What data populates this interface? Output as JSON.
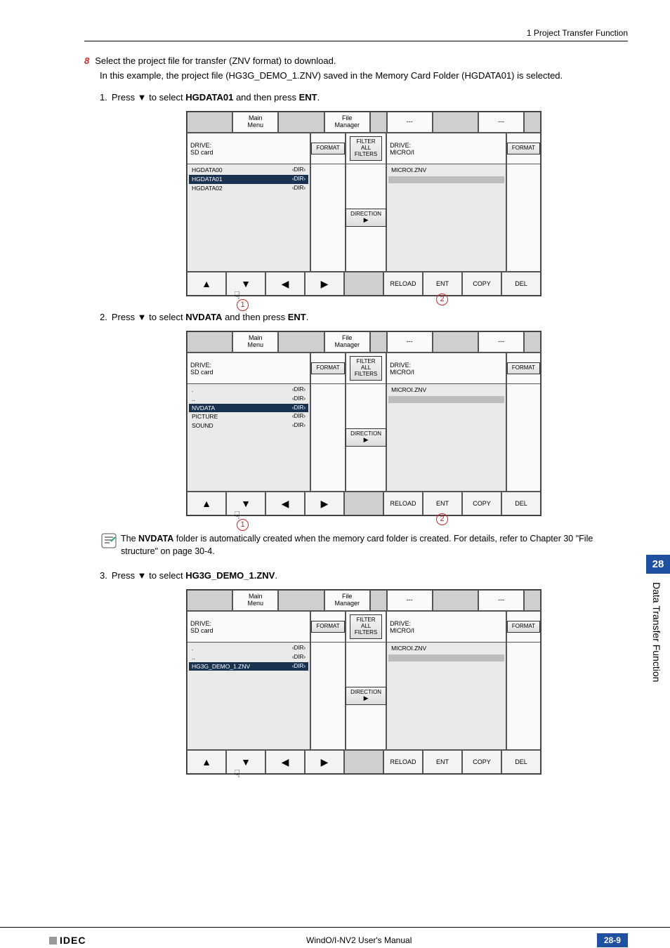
{
  "header": {
    "section": "1 Project Transfer Function"
  },
  "step8": {
    "num": "8",
    "line1": "Select the project file for transfer (ZNV format) to download.",
    "line2": "In this example, the project file (HG3G_DEMO_1.ZNV) saved in the Memory Card Folder (HGDATA01) is selected."
  },
  "sub1": {
    "num": "1.",
    "pre": "Press ▼ to select ",
    "bold1": "HGDATA01",
    "mid": " and then press ",
    "bold2": "ENT",
    "post": "."
  },
  "sub2": {
    "num": "2.",
    "pre": "Press ▼ to select ",
    "bold1": "NVDATA",
    "mid": " and then press ",
    "bold2": "ENT",
    "post": "."
  },
  "sub3": {
    "num": "3.",
    "pre": "Press ▼ to select ",
    "bold1": "HG3G_DEMO_1.ZNV",
    "post": "."
  },
  "note": {
    "pre": "The ",
    "bold": "NVDATA",
    "rest": " folder is automatically created when the memory card folder is created. For details, refer to Chapter 30 \"File structure\" on page 30-4."
  },
  "panel_common": {
    "main_menu": "Main\nMenu",
    "file_manager": "File\nManager",
    "dashes": "---",
    "drive_label": "DRIVE:",
    "sd_card": "SD  card",
    "microi": "MICRO/I",
    "format": "FORMAT",
    "filter_all": "FILTER\nALL\nFILTERS",
    "direction": "DIRECTION",
    "reload": "RELOAD",
    "ent": "ENT",
    "copy": "COPY",
    "del": "DEL",
    "dir": "‹DIR›",
    "microi_znv": "MICROI.ZNV",
    "arrow_right": "▶"
  },
  "panel1_rows": [
    {
      "name": "HGDATA00",
      "sel": false
    },
    {
      "name": "HGDATA01",
      "sel": true
    },
    {
      "name": "HGDATA02",
      "sel": false
    }
  ],
  "panel2_rows": [
    {
      "name": ".",
      "sel": false
    },
    {
      "name": "..",
      "sel": false
    },
    {
      "name": "NVDATA",
      "sel": true
    },
    {
      "name": "PICTURE",
      "sel": false
    },
    {
      "name": "SOUND",
      "sel": false
    }
  ],
  "panel3_rows": [
    {
      "name": ".",
      "sel": false
    },
    {
      "name": "..",
      "sel": false
    },
    {
      "name": "HG3G_DEMO_1.ZNV",
      "sel": true
    }
  ],
  "circles": {
    "c1": "1",
    "c2": "2"
  },
  "sidetab": {
    "num": "28",
    "label": "Data Transfer Function"
  },
  "footer": {
    "center": "WindO/I-NV2 User's Manual",
    "page": "28-9",
    "brand": "IDEC"
  }
}
